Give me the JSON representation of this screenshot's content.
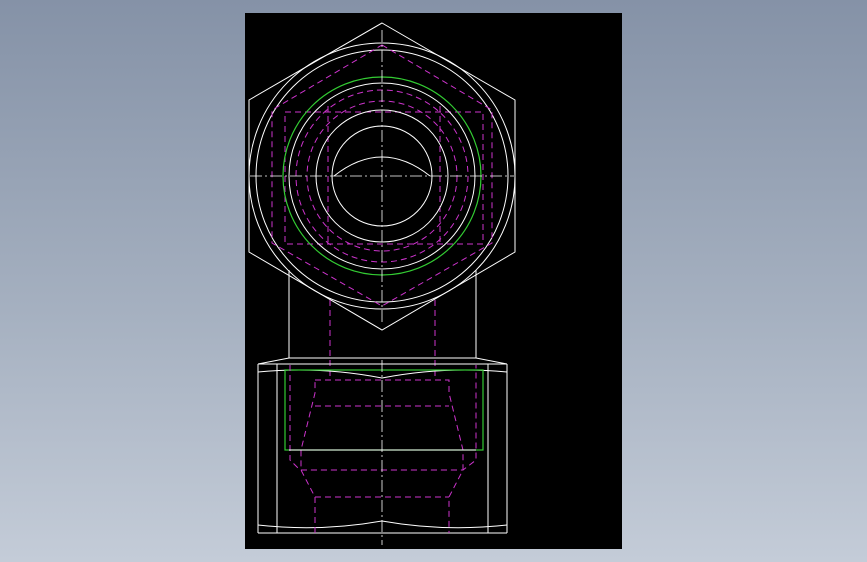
{
  "viewport": {
    "background": "#000000",
    "workspace_gradient": [
      "#8592a7",
      "#c4ccd8"
    ]
  },
  "drawing": {
    "views": [
      "top-view-hex-nut",
      "front-view-body"
    ],
    "line_colors": {
      "outline": "#ffffff",
      "hidden": "#cc33cc",
      "thread": "#33cc33",
      "centerline": "#ffffff"
    }
  }
}
